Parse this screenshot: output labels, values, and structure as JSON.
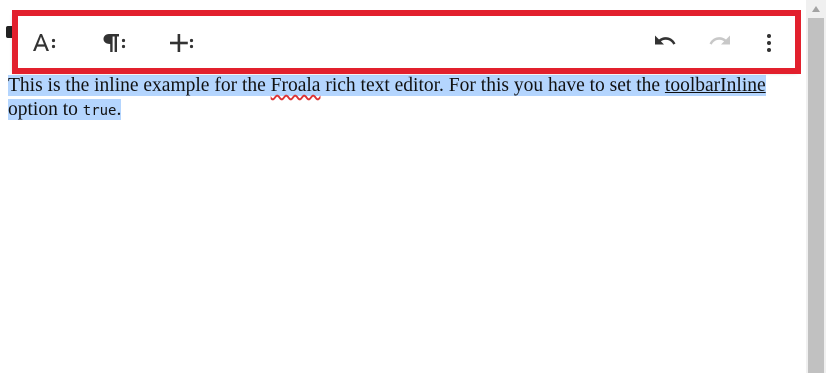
{
  "editor": {
    "text_part1": "This is the inline example for the ",
    "link_froala": "Froala",
    "text_part2": " rich text editor. For this you have to set the ",
    "link_toolbarInline": "toolbarInline",
    "text_part3": "option to ",
    "code_value": "true",
    "text_part4": "."
  },
  "toolbar": {
    "buttons": [
      {
        "name": "text-format",
        "icon": "text-format-more-icon"
      },
      {
        "name": "paragraph-format",
        "icon": "paragraph-more-icon"
      },
      {
        "name": "insert",
        "icon": "insert-more-icon"
      },
      {
        "name": "undo",
        "icon": "undo-icon"
      },
      {
        "name": "redo",
        "icon": "redo-icon",
        "disabled": true
      },
      {
        "name": "more",
        "icon": "vertical-dots-icon"
      }
    ]
  },
  "colors": {
    "highlight_border": "#e2202d",
    "selection": "#b4d5fe",
    "icon": "#333333",
    "icon_disabled": "#c8c8c8"
  }
}
